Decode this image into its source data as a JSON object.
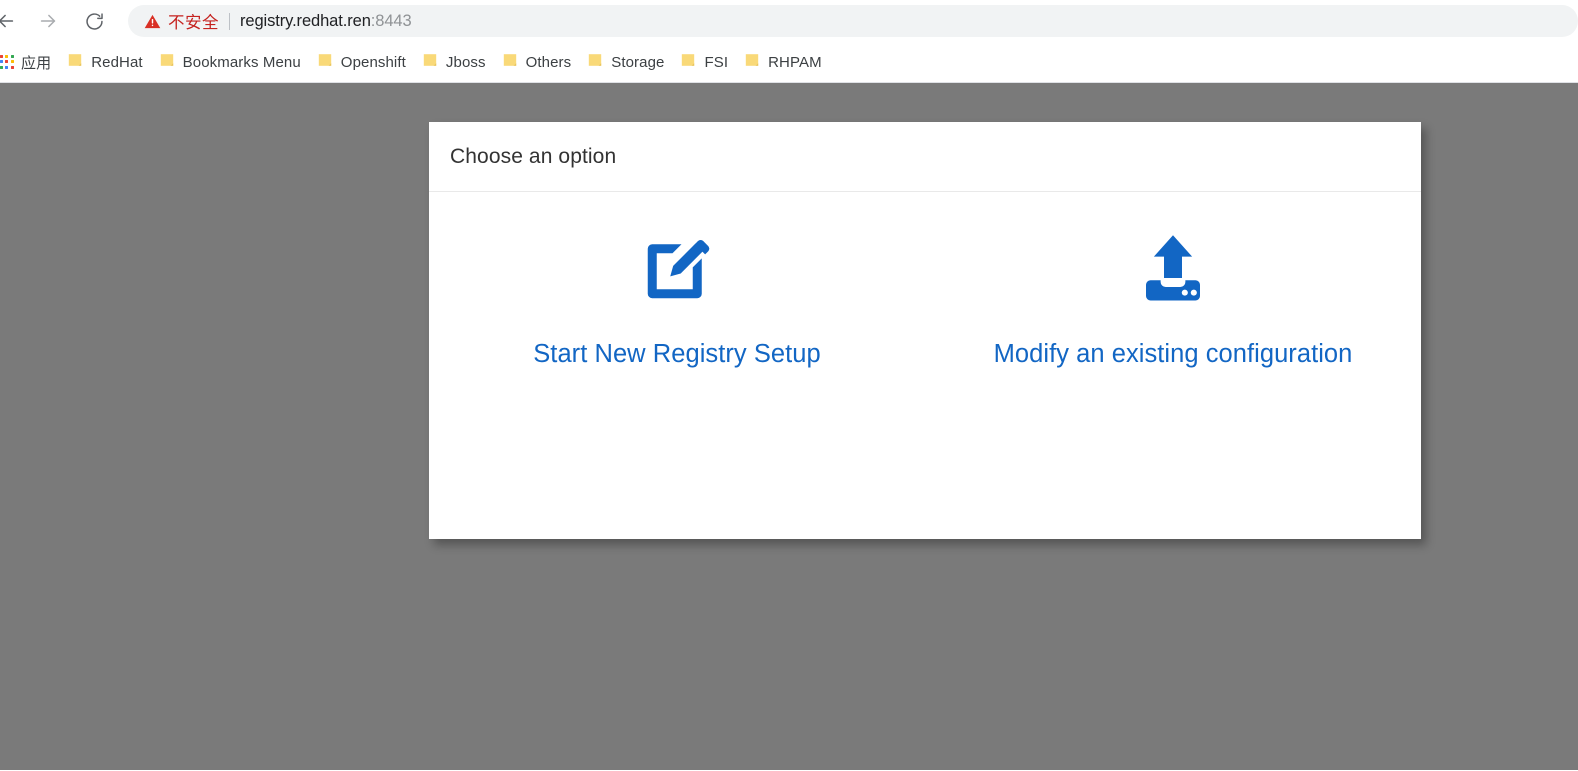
{
  "browser": {
    "toolbar": {
      "back_icon": "back-arrow-icon",
      "forward_icon": "forward-arrow-icon",
      "reload_icon": "reload-icon",
      "omnibox": {
        "security_icon": "warning-triangle-icon",
        "security_text": "不安全",
        "separator": "|",
        "url_host": "registry.redhat.ren",
        "url_port": ":8443",
        "full_url": "registry.redhat.ren:8443"
      }
    },
    "bookmarks_bar": {
      "apps_shortcut": {
        "icon": "apps-grid-icon",
        "label": "应用"
      },
      "items": [
        {
          "icon": "folder-icon",
          "label": "RedHat"
        },
        {
          "icon": "folder-icon",
          "label": "Bookmarks Menu"
        },
        {
          "icon": "folder-icon",
          "label": "Openshift"
        },
        {
          "icon": "folder-icon",
          "label": "Jboss"
        },
        {
          "icon": "folder-icon",
          "label": "Others"
        },
        {
          "icon": "folder-icon",
          "label": "Storage"
        },
        {
          "icon": "folder-icon",
          "label": "FSI"
        },
        {
          "icon": "folder-icon",
          "label": "RHPAM"
        }
      ]
    }
  },
  "page": {
    "backdrop_color": "#7a7a7a",
    "dialog": {
      "title": "Choose an option",
      "options": [
        {
          "icon": "edit-pencil-square-icon",
          "label": "Start New Registry Setup"
        },
        {
          "icon": "upload-to-drive-icon",
          "label": "Modify an existing configuration"
        }
      ]
    }
  },
  "colors": {
    "link_blue": "#1266c4",
    "security_red": "#c5221f",
    "backdrop_gray": "#7a7a7a",
    "folder_yellow": "#f8d775",
    "omnibox_gray": "#f1f3f4"
  }
}
